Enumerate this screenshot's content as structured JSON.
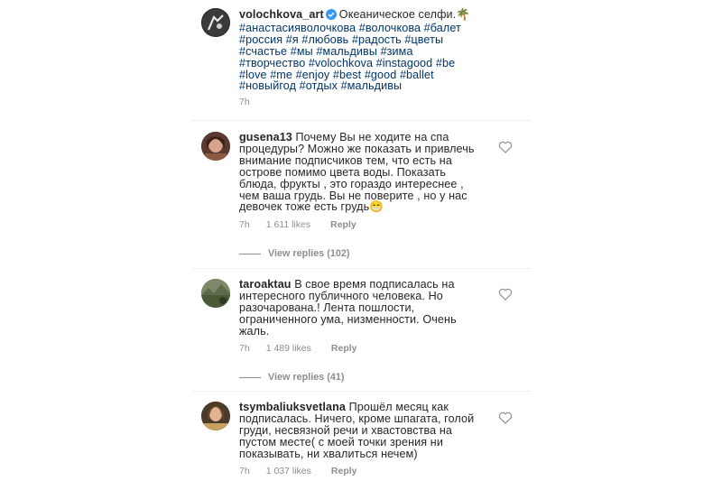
{
  "post": {
    "username": "volochkova_art",
    "caption": "Океаническое селфи.",
    "caption_emoji": "🌴",
    "tags": "#анастасияволочкова #волочкова #балет\n#россия #я #любовь #радость #цветы\n#счастье #мы #мальдивы #зима\n#творчество #volochkova #instagood #be\n#love #me #enjoy #best #good #ballet\n#новыйгод #отдых #мальдивы",
    "time": "7h",
    "verified_icon": "verified-badge-icon"
  },
  "comments": [
    {
      "username": "gusena13",
      "text": "Почему Вы не ходите на спа\nпроцедуры? Можно же показать и привлечь\nвнимание подписчиков тем, что есть на\nострове помимо цвета воды. Показать\nблюда, фрукты , это гораздо интереснее ,\nчем ваша грудь. Вы не поверите , но у нас\nдевочек тоже есть грудь",
      "emoji": "😁",
      "time": "7h",
      "likes": "1 611 likes",
      "reply": "Reply",
      "view_replies": "View replies (102)"
    },
    {
      "username": "taroaktau",
      "text": "В свое время подписалась на\nинтересного публичного человека. Но\nразочарована.! Лента пошлости,\nограниченного ума, низменности. Очень\nжаль.",
      "time": "7h",
      "likes": "1 489 likes",
      "reply": "Reply",
      "view_replies": "View replies (41)"
    },
    {
      "username": "tsymbaliuksvetlana",
      "text": "Прошёл месяц как\nподписалась. Ничего, кроме шпагата, голой\nгруди, несвязной речи и хвастовства на\nпустом месте( с моей точки зрения ни\nпоказывать, ни хвалиться нечем)",
      "time": "7h",
      "likes": "1 037 likes",
      "reply": "Reply"
    }
  ],
  "colors": {
    "text": "#262626",
    "secondary": "#8e8e8e",
    "verified": "#3897f0"
  }
}
